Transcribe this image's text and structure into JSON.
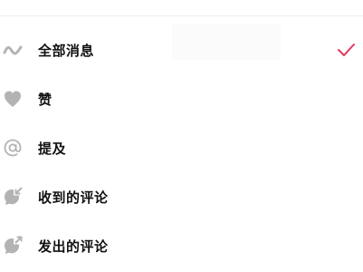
{
  "menu": {
    "items": [
      {
        "label": "全部消息",
        "icon": "wave-icon",
        "selected": true
      },
      {
        "label": "赞",
        "icon": "heart-icon",
        "selected": false
      },
      {
        "label": "提及",
        "icon": "at-icon",
        "selected": false
      },
      {
        "label": "收到的评论",
        "icon": "comment-received-icon",
        "selected": false
      },
      {
        "label": "发出的评论",
        "icon": "comment-sent-icon",
        "selected": false
      }
    ]
  },
  "colors": {
    "icon": "#b3b3b3",
    "text": "#111111",
    "check": "#e0395b"
  }
}
